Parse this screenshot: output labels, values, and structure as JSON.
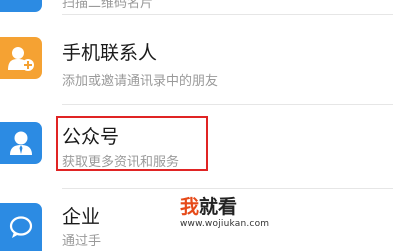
{
  "colors": {
    "accent_orange": "#f5a233",
    "accent_blue": "#2c8be3",
    "highlight_red": "#e02424",
    "watermark_orange": "#e64a19"
  },
  "list": {
    "top_partial": {
      "subtitle": "扫描二维码名片",
      "icon": "qr-code-icon"
    },
    "items": [
      {
        "title": "手机联系人",
        "subtitle": "添加或邀请通讯录中的朋友",
        "icon": "add-contact-icon"
      },
      {
        "title": "公众号",
        "subtitle": "获取更多资讯和服务",
        "icon": "official-account-icon"
      },
      {
        "title": "企业",
        "subtitle": "通过手",
        "icon": "enterprise-chat-icon"
      }
    ]
  },
  "watermark": {
    "logo_part1": "我",
    "logo_part2": "就看",
    "url": "www.wojiukan.com"
  }
}
